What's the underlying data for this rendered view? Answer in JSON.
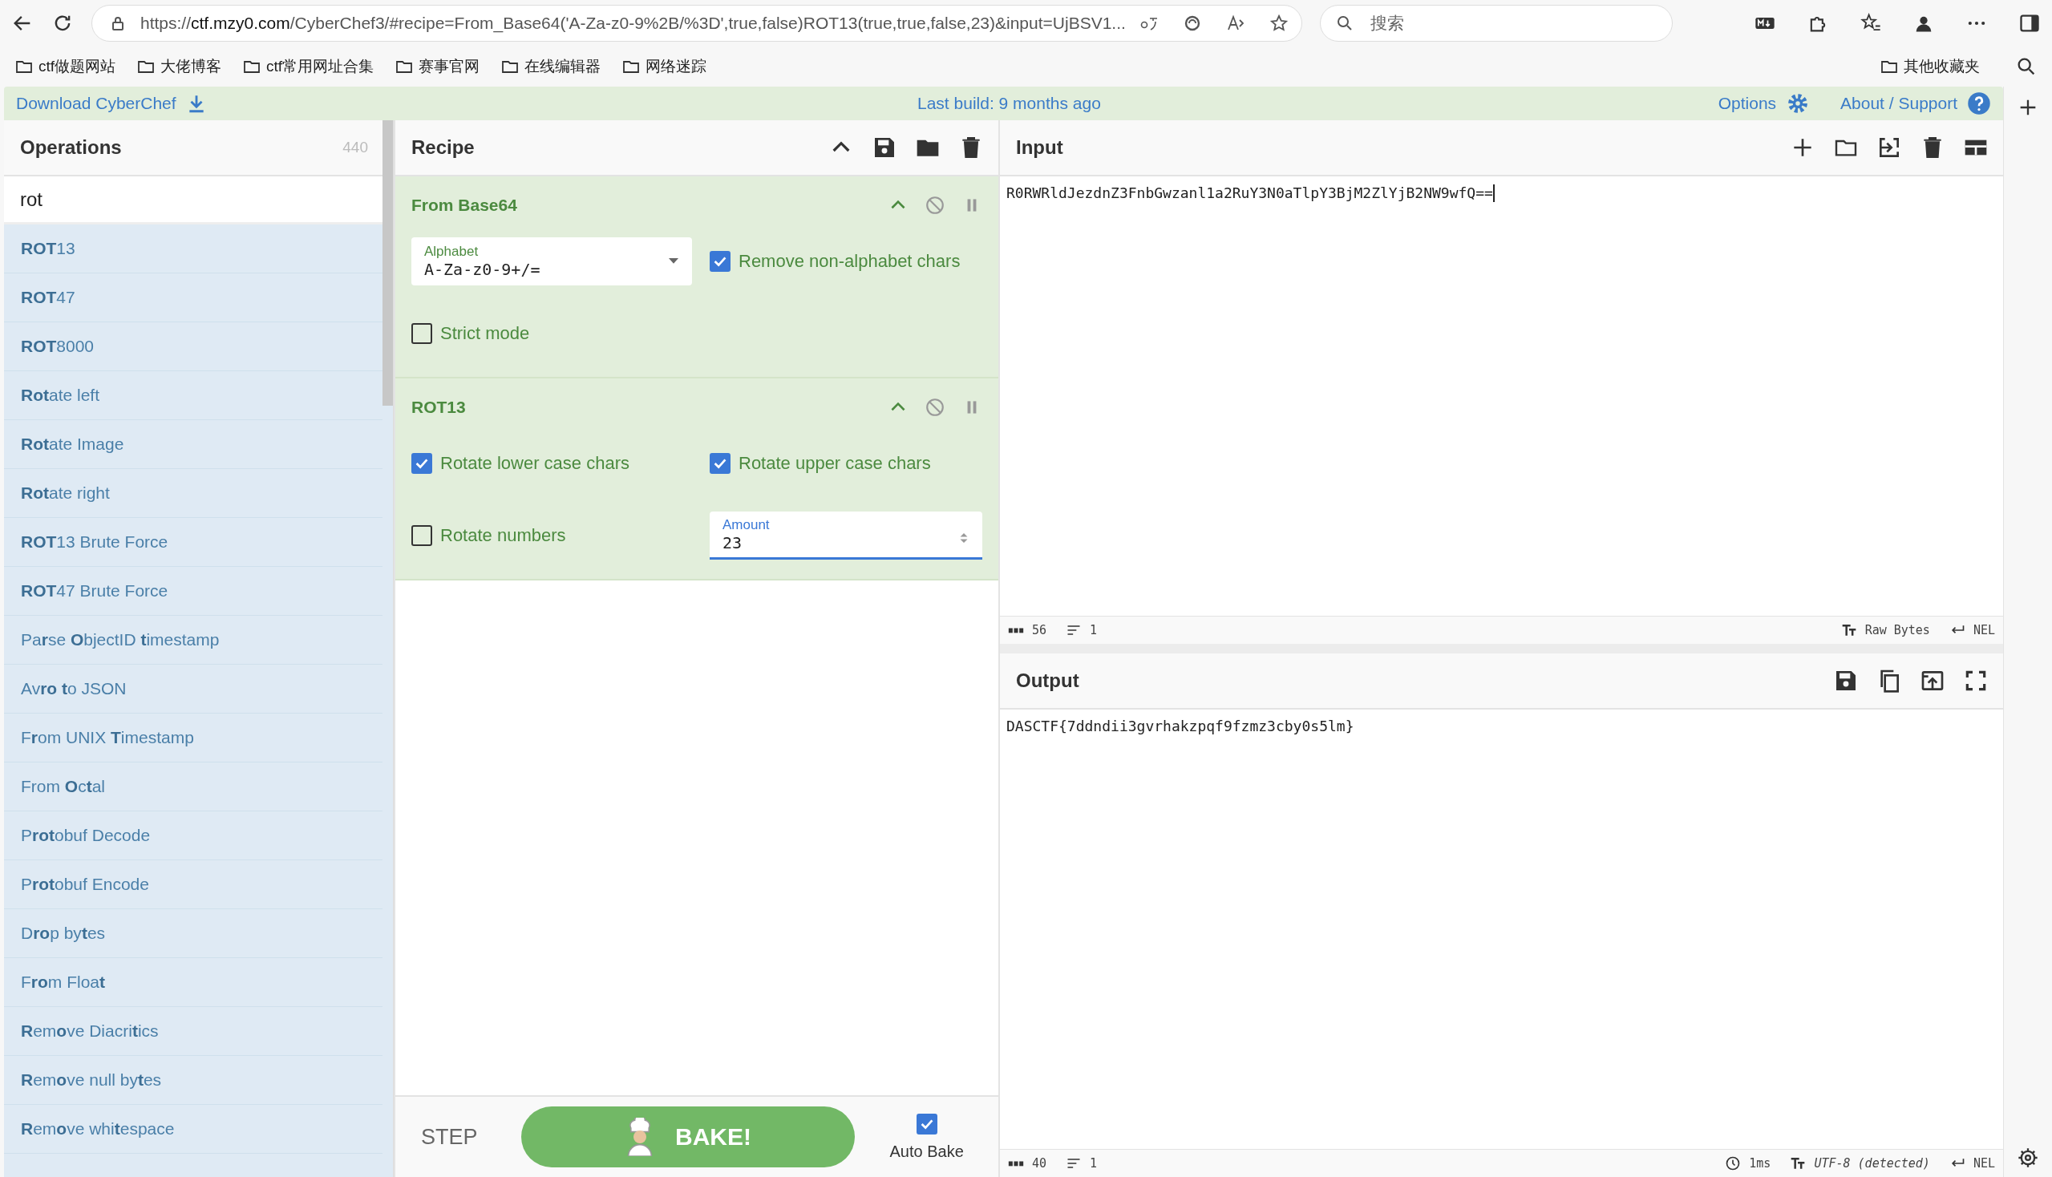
{
  "browser": {
    "url_host": "ctf.mzy0.com",
    "url_rest": "/CyberChef3/#recipe=From_Base64('A-Za-z0-9%2B/%3D',true,false)ROT13(true,true,false,23)&input=UjBSV1...",
    "url_scheme": "https://",
    "search_placeholder": "搜索",
    "bookmarks": [
      "ctf做题网站",
      "大佬博客",
      "ctf常用网址合集",
      "赛事官网",
      "在线编辑器",
      "网络迷踪"
    ],
    "other_bookmarks": "其他收藏夹"
  },
  "banner": {
    "download": "Download CyberChef",
    "build": "Last build: 9 months ago",
    "options": "Options",
    "about": "About / Support"
  },
  "operations": {
    "title": "Operations",
    "count": "440",
    "search_value": "rot",
    "items": [
      "**ROT**13",
      "**ROT**47",
      "**ROT**8000",
      "**Rot**ate left",
      "**Rot**ate Image",
      "**Rot**ate right",
      "**ROT**13 Brute Force",
      "**ROT**47 Brute Force",
      "Pa**r**se **O**bjectID **t**imestamp",
      "Av**ro** **t**o JSON",
      "F**r**om UNIX **T**imestamp",
      "From **O**c**t**al",
      "P**rot**obuf Decode",
      "P**rot**obuf Encode",
      "D**ro**p by**t**es",
      "F**ro**m Floa**t**",
      "**R**em**o**ve Diacri**t**ics",
      "**R**em**o**ve null by**t**es",
      "**R**em**o**ve whi**t**espace"
    ]
  },
  "recipe": {
    "title": "Recipe",
    "ops": [
      {
        "name": "From Base64",
        "args": [
          {
            "kind": "select",
            "label": "Alphabet",
            "value": "A-Za-z0-9+/="
          },
          {
            "kind": "checkbox",
            "label": "Remove non-alphabet chars",
            "checked": true
          },
          {
            "kind": "checkbox",
            "label": "Strict mode",
            "checked": false
          }
        ]
      },
      {
        "name": "ROT13",
        "args": [
          {
            "kind": "checkbox",
            "label": "Rotate lower case chars",
            "checked": true
          },
          {
            "kind": "checkbox",
            "label": "Rotate upper case chars",
            "checked": true
          },
          {
            "kind": "checkbox",
            "label": "Rotate numbers",
            "checked": false
          },
          {
            "kind": "number",
            "label": "Amount",
            "value": "23"
          }
        ]
      }
    ],
    "step": "STEP",
    "bake": "BAKE!",
    "auto_bake": {
      "label": "Auto Bake",
      "checked": true
    }
  },
  "input": {
    "title": "Input",
    "value": "R0RWRldJezdnZ3FnbGwzanl1a2RuY3N0aTlpY3BjM2ZlYjB2NW9wfQ==",
    "chars": "56",
    "lines": "1",
    "format": "Raw Bytes",
    "eol": "NEL"
  },
  "output": {
    "title": "Output",
    "value": "DASCTF{7ddndii3gvrhakzpqf9fzmz3cby0s5lm}",
    "chars": "40",
    "lines": "1",
    "time": "1ms",
    "encoding": "UTF-8 (detected)",
    "eol": "NEL"
  }
}
